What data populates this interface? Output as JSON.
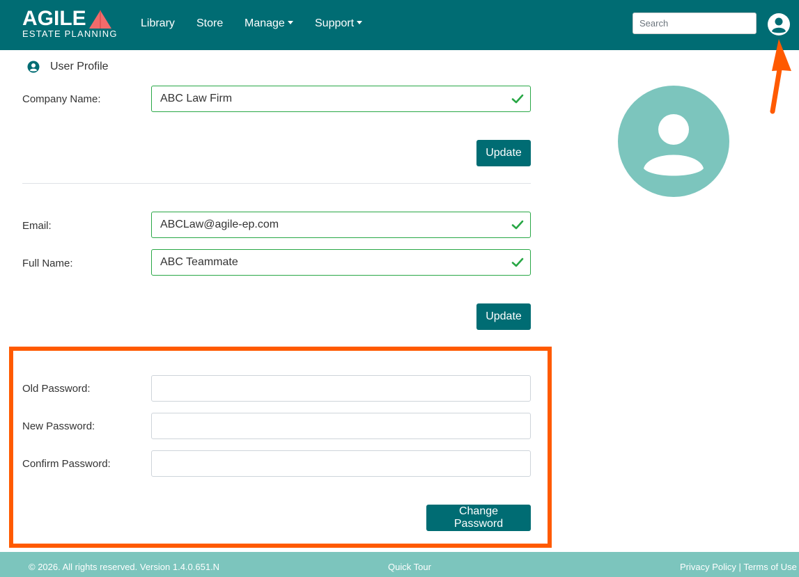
{
  "brand": {
    "logo_main": "AGILE",
    "logo_sub": "ESTATE PLANNING",
    "navy": "#006c73",
    "accent": "#f26b6b"
  },
  "nav": {
    "library": "Library",
    "store": "Store",
    "manage": "Manage",
    "support": "Support",
    "search_placeholder": "Search"
  },
  "profile": {
    "heading": "User Profile",
    "company_label": "Company Name:",
    "company_value": "ABC Law Firm",
    "update_label": "Update",
    "email_label": "Email:",
    "email_value": "ABCLaw@agile-ep.com",
    "fullname_label": "Full Name:",
    "fullname_value": "ABC Teammate",
    "update2_label": "Update"
  },
  "password": {
    "old_label": "Old Password:",
    "new_label": "New Password:",
    "confirm_label": "Confirm Password:",
    "change_label": "Change Password"
  },
  "footer": {
    "copyright": "© 2026. All rights reserved. Version 1.4.0.651.N",
    "quick_tour": "Quick Tour",
    "privacy": "Privacy Policy",
    "separator": "|",
    "terms": "Terms of Use"
  },
  "icons": {
    "user_nav": "user-circle-icon",
    "profile_head": "user-circle-icon",
    "check": "check-icon",
    "avatar": "avatar-placeholder-icon",
    "arrow": "arrow-up-annotation"
  },
  "annotations": {
    "highlight_color": "#ff5a00"
  }
}
